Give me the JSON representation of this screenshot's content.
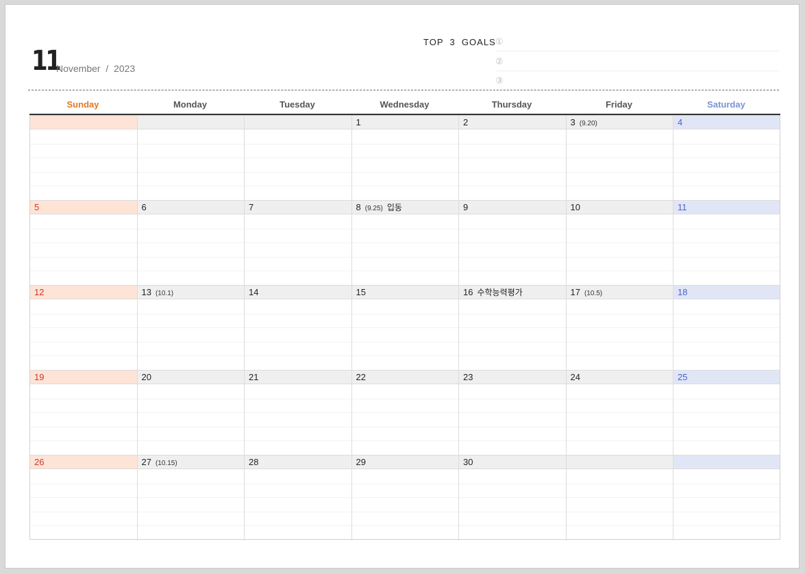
{
  "header": {
    "month_number": "11",
    "month_label": "November  /  2023",
    "goals_title": "TOP  3  GOALS",
    "goal_markers": [
      "①",
      "②",
      "③"
    ]
  },
  "weekdays": [
    "Sunday",
    "Monday",
    "Tuesday",
    "Wednesday",
    "Thursday",
    "Friday",
    "Saturday"
  ],
  "colors": {
    "sunday_text": "#e07a1f",
    "saturday_text": "#7b93d6",
    "weekday_text": "#555555",
    "sunday_cell": "#fde4d6",
    "saturday_cell": "#e1e6f7",
    "weekday_cell": "#efefef",
    "sunday_number": "#d0362a",
    "saturday_number": "#4a63c7"
  },
  "weeks": [
    [
      {
        "day": ""
      },
      {
        "day": ""
      },
      {
        "day": ""
      },
      {
        "day": "1"
      },
      {
        "day": "2"
      },
      {
        "day": "3",
        "lunar": "(9.20)"
      },
      {
        "day": "4"
      }
    ],
    [
      {
        "day": "5"
      },
      {
        "day": "6"
      },
      {
        "day": "7"
      },
      {
        "day": "8",
        "lunar": "(9.25)",
        "event": "입동"
      },
      {
        "day": "9"
      },
      {
        "day": "10"
      },
      {
        "day": "11"
      }
    ],
    [
      {
        "day": "12"
      },
      {
        "day": "13",
        "lunar": "(10.1)"
      },
      {
        "day": "14"
      },
      {
        "day": "15"
      },
      {
        "day": "16",
        "event": "수학능력평가"
      },
      {
        "day": "17",
        "lunar": "(10.5)"
      },
      {
        "day": "18"
      }
    ],
    [
      {
        "day": "19"
      },
      {
        "day": "20"
      },
      {
        "day": "21"
      },
      {
        "day": "22"
      },
      {
        "day": "23"
      },
      {
        "day": "24"
      },
      {
        "day": "25"
      }
    ],
    [
      {
        "day": "26"
      },
      {
        "day": "27",
        "lunar": "(10.15)"
      },
      {
        "day": "28"
      },
      {
        "day": "29"
      },
      {
        "day": "30"
      },
      {
        "day": ""
      },
      {
        "day": ""
      }
    ]
  ]
}
